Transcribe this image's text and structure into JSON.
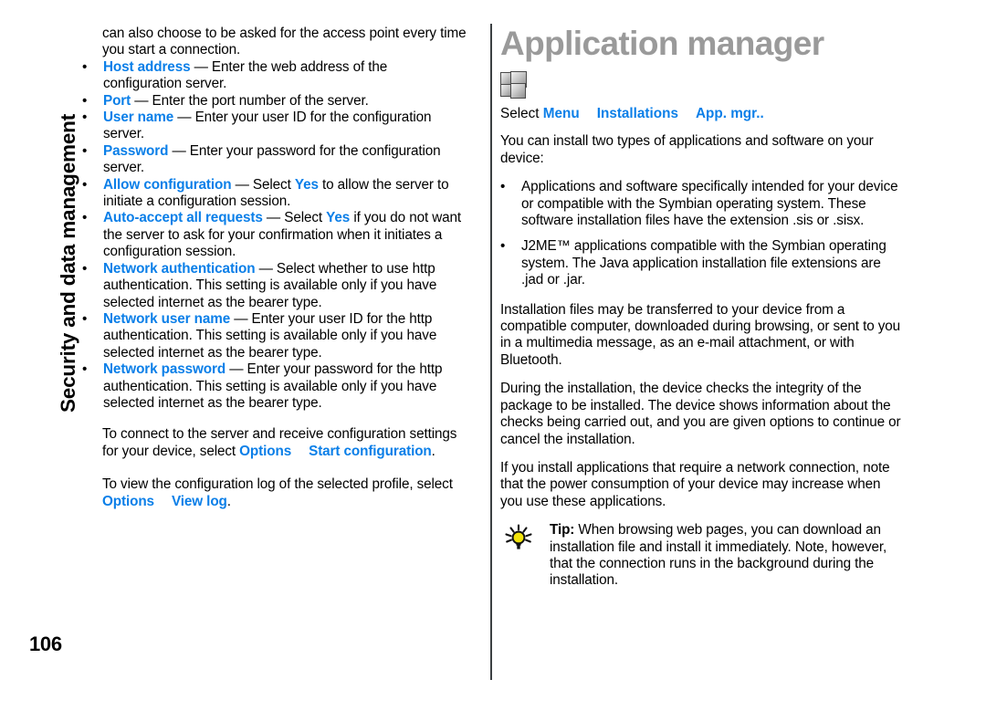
{
  "chapter_tab": {
    "label": "Security and data management"
  },
  "page_number": "106",
  "left_column": {
    "continued_paragraph": "can also choose to be asked for the access point every time you start a connection.",
    "settings_bullets": [
      {
        "term": "Host address",
        "desc": " — Enter the web address of the configuration server."
      },
      {
        "term": "Port",
        "desc": " — Enter the port number of the server."
      },
      {
        "term": "User name",
        "desc": " — Enter your user ID for the configuration server."
      },
      {
        "term": "Password",
        "desc": " — Enter your password for the configuration server."
      },
      {
        "term": "Allow configuration",
        "desc_before": " — Select ",
        "value": "Yes",
        "desc_after": " to allow the server to initiate a configuration session."
      },
      {
        "term": "Auto-accept all requests",
        "desc_before": " — Select ",
        "value": "Yes",
        "desc_after": " if you do not want the server to ask for your confirmation when it initiates a configuration session."
      },
      {
        "term": "Network authentication",
        "desc": " — Select whether to use http authentication. This setting is available only if you have selected internet as the bearer type."
      },
      {
        "term": "Network user name",
        "desc": " — Enter your user ID for the http authentication. This setting is available only if you have selected internet as the bearer type."
      },
      {
        "term": "Network password",
        "desc": " — Enter your password for the http authentication. This setting is available only if you have selected internet as the bearer type."
      }
    ],
    "connect_paragraph": {
      "before": "To connect to the server and receive configuration settings for your device, select ",
      "menu1": "Options",
      "menu2": "Start configuration",
      "after": "."
    },
    "viewlog_paragraph": {
      "before": "To view the configuration log of the selected profile, select ",
      "menu1": "Options",
      "menu2": "View log",
      "after": "."
    }
  },
  "right_column": {
    "title": "Application manager",
    "title_icon": "app-cubes-icon",
    "select_path": {
      "select_label": "Select ",
      "item1": "Menu",
      "item2": "Installations",
      "item3": "App. mgr.."
    },
    "intro": "You can install two types of applications and software on your device:",
    "type_bullets": [
      "Applications and software specifically intended for your device or compatible with the Symbian operating system. These software installation files have the extension .sis or .sisx.",
      "J2ME™ applications compatible with the Symbian operating system. The Java application installation file extensions are .jad or .jar."
    ],
    "paragraphs": [
      "Installation files may be transferred to your device from a compatible computer, downloaded during browsing, or sent to you in a multimedia message, as an e-mail attachment, or with Bluetooth.",
      "During the installation, the device checks the integrity of the package to be installed. The device shows information about the checks being carried out, and you are given options to continue or cancel the installation.",
      "If you install applications that require a network connection, note that the power consumption of your device may increase when you use these applications."
    ],
    "tip": {
      "icon": "lightbulb-icon",
      "label": "Tip:",
      "text": " When browsing web pages, you can download an installation file and install it immediately. Note, however, that the connection runs in the background during the installation."
    }
  },
  "colors": {
    "link_blue": "#0b7fe8",
    "title_gray": "#9a9a9a",
    "divider": "#3c4043",
    "bulb_yellow": "#f2e40c"
  },
  "bullet_glyph": "•"
}
